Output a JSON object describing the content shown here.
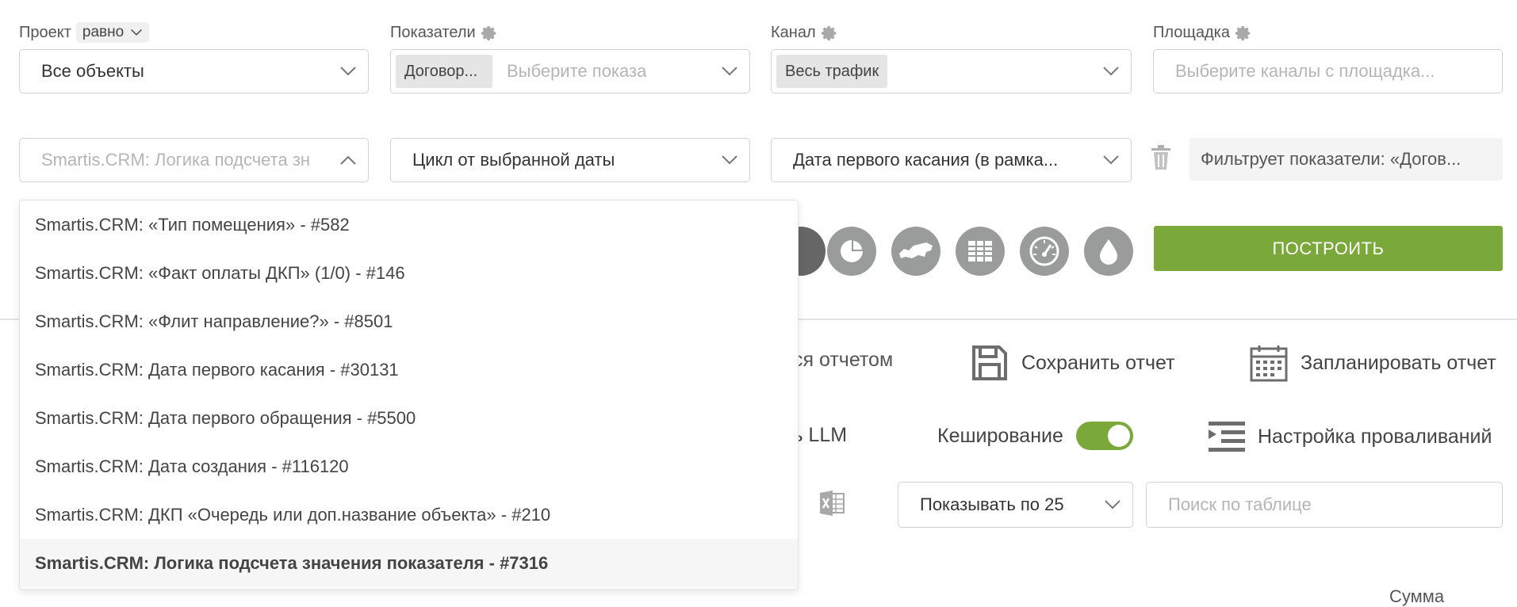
{
  "filters": {
    "project": {
      "label": "Проект",
      "operator": "равно",
      "value": "Все объекты"
    },
    "metrics": {
      "label": "Показатели",
      "tag": "Договор...",
      "placeholder": "Выберите показа"
    },
    "channel": {
      "label": "Канал",
      "tag": "Весь трафик"
    },
    "platform": {
      "label": "Площадка",
      "placeholder": "Выберите каналы с площадка..."
    }
  },
  "row2": {
    "logic_select": {
      "placeholder": "Smartis.CRM: Логика подсчета зн"
    },
    "cycle_select": {
      "value": "Цикл от выбранной даты"
    },
    "date_select": {
      "value": "Дата первого касания (в рамка..."
    },
    "filter_note": "Фильтрует показатели: «Догов..."
  },
  "chart_icons": [
    "pie-chart-icon",
    "map-icon",
    "table-icon",
    "gauge-icon",
    "drop-icon"
  ],
  "build_button": "ПОСТРОИТЬ",
  "actions": {
    "share_partial": "ся отчетом",
    "save": "Сохранить отчет",
    "schedule": "Запланировать отчет",
    "llm_partial": "ть LLM",
    "caching": "Кеширование",
    "caching_on": true,
    "drilldown": "Настройка проваливаний",
    "page_size": "Показывать по 25",
    "table_search_placeholder": "Поиск по таблице",
    "column_partial": "Сумма"
  },
  "dropdown_options": [
    "Smartis.CRM: «Тип помещения» - #582",
    "Smartis.CRM: «Факт оплаты ДКП» (1/0) - #146",
    "Smartis.CRM: «Флит направление?» - #8501",
    "Smartis.CRM: Дата первого касания - #30131",
    "Smartis.CRM: Дата первого обращения - #5500",
    "Smartis.CRM: Дата создания - #116120",
    "Smartis.CRM: ДКП «Очередь или доп.название объекта» - #210",
    "Smartis.CRM: Логика подсчета значения показателя - #7316"
  ],
  "selected_option_index": 7,
  "colors": {
    "accent_green": "#7aa83a",
    "icon_gray": "#9a9c9c"
  }
}
